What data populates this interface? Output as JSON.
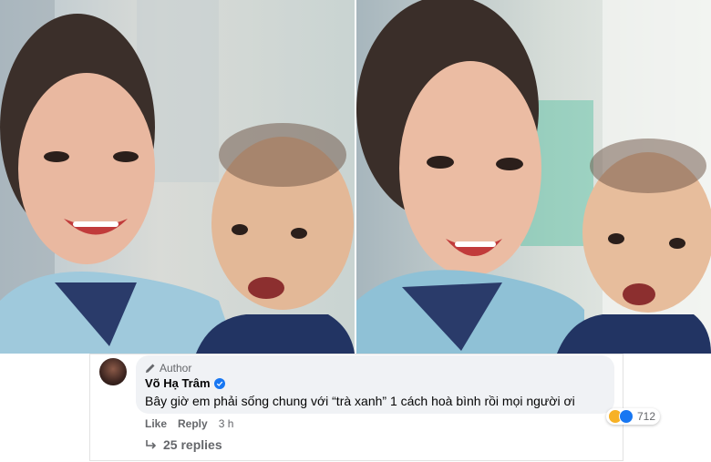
{
  "comment": {
    "badge": "Author",
    "name": "Võ Hạ Trâm",
    "text": "Bây giờ em phải sống chung với “trà xanh” 1 cách hoà bình rồi mọi người ơi",
    "reaction_count": "712",
    "reaction_icons": [
      "haha-icon",
      "like-icon"
    ],
    "actions": {
      "like": "Like",
      "reply": "Reply",
      "time": "3 h"
    },
    "replies": "25 replies"
  },
  "colors": {
    "bubble": "#f0f2f5",
    "verified": "#1877f2",
    "secondary_text": "#65676b",
    "primary_text": "#050505"
  }
}
